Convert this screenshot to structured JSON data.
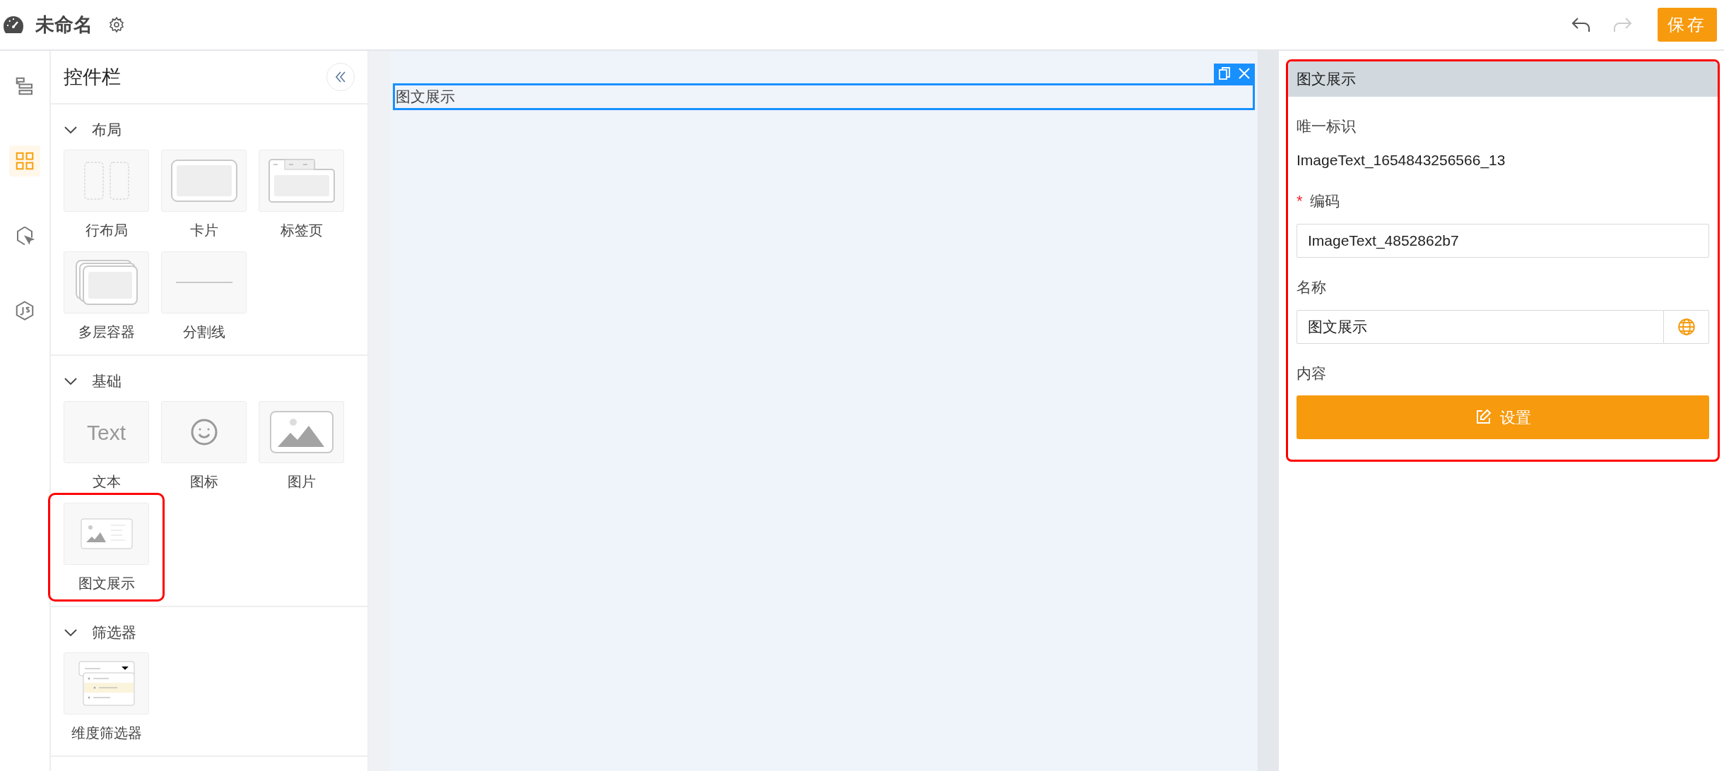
{
  "header": {
    "title": "未命名",
    "undo": {
      "disabled": false
    },
    "redo": {
      "disabled": true
    },
    "save": "保存"
  },
  "rail": [
    {
      "kind": "outline",
      "selected": false
    },
    {
      "kind": "widgets",
      "selected": true
    },
    {
      "kind": "interaction",
      "selected": false
    },
    {
      "kind": "script",
      "selected": false
    }
  ],
  "widget_panel": {
    "title": "控件栏",
    "sections": [
      {
        "title": "布局",
        "expanded": true,
        "items": [
          {
            "kind": "row-layout",
            "label": "行布局",
            "highlighted": false
          },
          {
            "kind": "card",
            "label": "卡片",
            "highlighted": false
          },
          {
            "kind": "tabs",
            "label": "标签页",
            "highlighted": false
          },
          {
            "kind": "layers",
            "label": "多层容器",
            "highlighted": false
          },
          {
            "kind": "divider",
            "label": "分割线",
            "highlighted": false
          }
        ]
      },
      {
        "title": "基础",
        "expanded": true,
        "items": [
          {
            "kind": "text",
            "label": "文本",
            "preview_text": "Text",
            "highlighted": false
          },
          {
            "kind": "icon",
            "label": "图标",
            "highlighted": false
          },
          {
            "kind": "image",
            "label": "图片",
            "highlighted": false
          },
          {
            "kind": "image-text",
            "label": "图文展示",
            "highlighted": true
          }
        ]
      },
      {
        "title": "筛选器",
        "expanded": true,
        "items": [
          {
            "kind": "filter",
            "label": "维度筛选器",
            "highlighted": false
          }
        ]
      }
    ]
  },
  "canvas": {
    "component": {
      "label": "图文展示",
      "selected": true
    }
  },
  "properties": {
    "title": "图文展示",
    "highlighted": true,
    "required_mark": "*",
    "fields": [
      {
        "kind": "static",
        "label": "唯一标识",
        "required": false,
        "value": "ImageText_1654843256566_13"
      },
      {
        "kind": "input",
        "label": "编码",
        "required": true,
        "value": "ImageText_4852862b7"
      },
      {
        "kind": "input-i18n",
        "label": "名称",
        "required": false,
        "value": "图文展示"
      },
      {
        "kind": "button",
        "label": "内容",
        "required": false,
        "button": "设置"
      }
    ]
  }
}
